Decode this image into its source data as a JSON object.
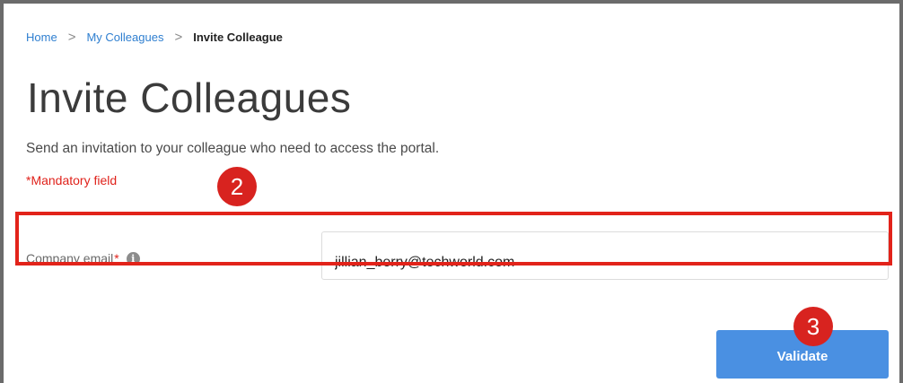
{
  "breadcrumb": {
    "items": [
      "Home",
      "My Colleagues"
    ],
    "separator": ">",
    "current": "Invite Colleague"
  },
  "page": {
    "title": "Invite Colleagues",
    "description": "Send an invitation to your colleague who need to access the portal.",
    "mandatory_note": "*Mandatory field"
  },
  "form": {
    "email_label": "Company email",
    "required_marker": "*",
    "info_icon": "i",
    "email_value": "jillian_berry@techworld.com"
  },
  "actions": {
    "validate_label": "Validate"
  },
  "annotations": {
    "step_2": "2",
    "step_3": "3"
  },
  "colors": {
    "link": "#2f7fd0",
    "mandatory": "#e0221b",
    "button": "#4a90e2",
    "annotation": "#d8231f"
  }
}
